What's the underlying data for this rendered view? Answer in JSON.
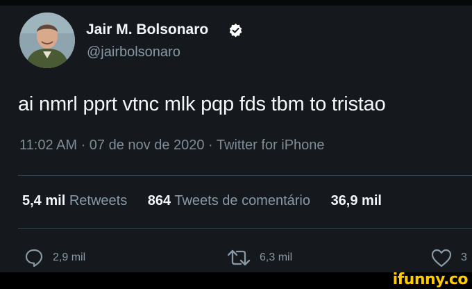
{
  "profile": {
    "name": "Jair M. Bolsonaro",
    "handle": "@jairbolsonaro"
  },
  "tweet": {
    "text": "ai nmrl pprt vtnc mlk pqp fds tbm to tristao",
    "meta": "11:02 AM · 07 de nov de 2020 · Twitter for iPhone"
  },
  "stats": {
    "retweets_count": "5,4 mil",
    "retweets_label": "Retweets",
    "comment_tweets_count": "864",
    "comment_tweets_label": "Tweets de comentário",
    "likes_count": "36,9 mil"
  },
  "actions": {
    "reply_count": "2,9 mil",
    "retweet_count": "6,3 mil",
    "like_count": "3"
  },
  "icons": {
    "reply": "reply-icon",
    "retweet": "retweet-icon",
    "like": "heart-icon",
    "verified": "verified-badge-icon"
  },
  "colors": {
    "background": "#15181c",
    "verified": "#ffffff",
    "watermark": "#ffcc00"
  },
  "watermark": "ifunny.co"
}
